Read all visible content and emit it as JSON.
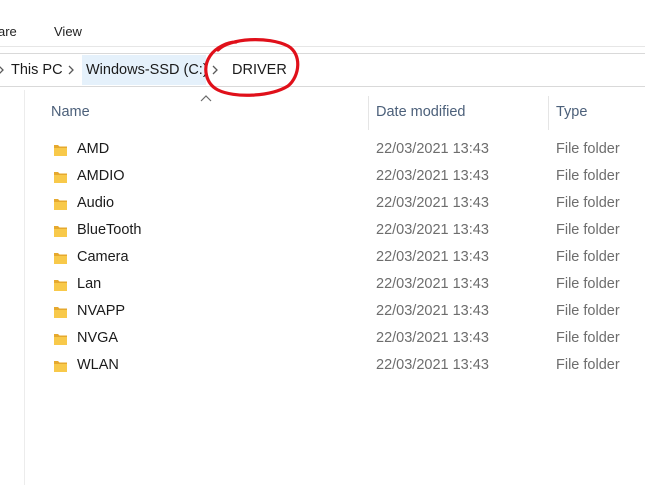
{
  "ribbon": {
    "tabs": [
      "are",
      "View"
    ]
  },
  "breadcrumb": [
    "This PC",
    "Windows-SSD (C:)",
    "DRIVER"
  ],
  "columns": {
    "name": "Name",
    "date": "Date modified",
    "type": "Type"
  },
  "rows": [
    {
      "name": "AMD",
      "date": "22/03/2021 13:43",
      "type": "File folder"
    },
    {
      "name": "AMDIO",
      "date": "22/03/2021 13:43",
      "type": "File folder"
    },
    {
      "name": "Audio",
      "date": "22/03/2021 13:43",
      "type": "File folder"
    },
    {
      "name": "BlueTooth",
      "date": "22/03/2021 13:43",
      "type": "File folder"
    },
    {
      "name": "Camera",
      "date": "22/03/2021 13:43",
      "type": "File folder"
    },
    {
      "name": "Lan",
      "date": "22/03/2021 13:43",
      "type": "File folder"
    },
    {
      "name": "NVAPP",
      "date": "22/03/2021 13:43",
      "type": "File folder"
    },
    {
      "name": "NVGA",
      "date": "22/03/2021 13:43",
      "type": "File folder"
    },
    {
      "name": "WLAN",
      "date": "22/03/2021 13:43",
      "type": "File folder"
    }
  ],
  "colors": {
    "folder": "#f8c94a",
    "folder_dark": "#e6a92e",
    "annotation": "#e0101a",
    "header_text": "#4c607a"
  }
}
